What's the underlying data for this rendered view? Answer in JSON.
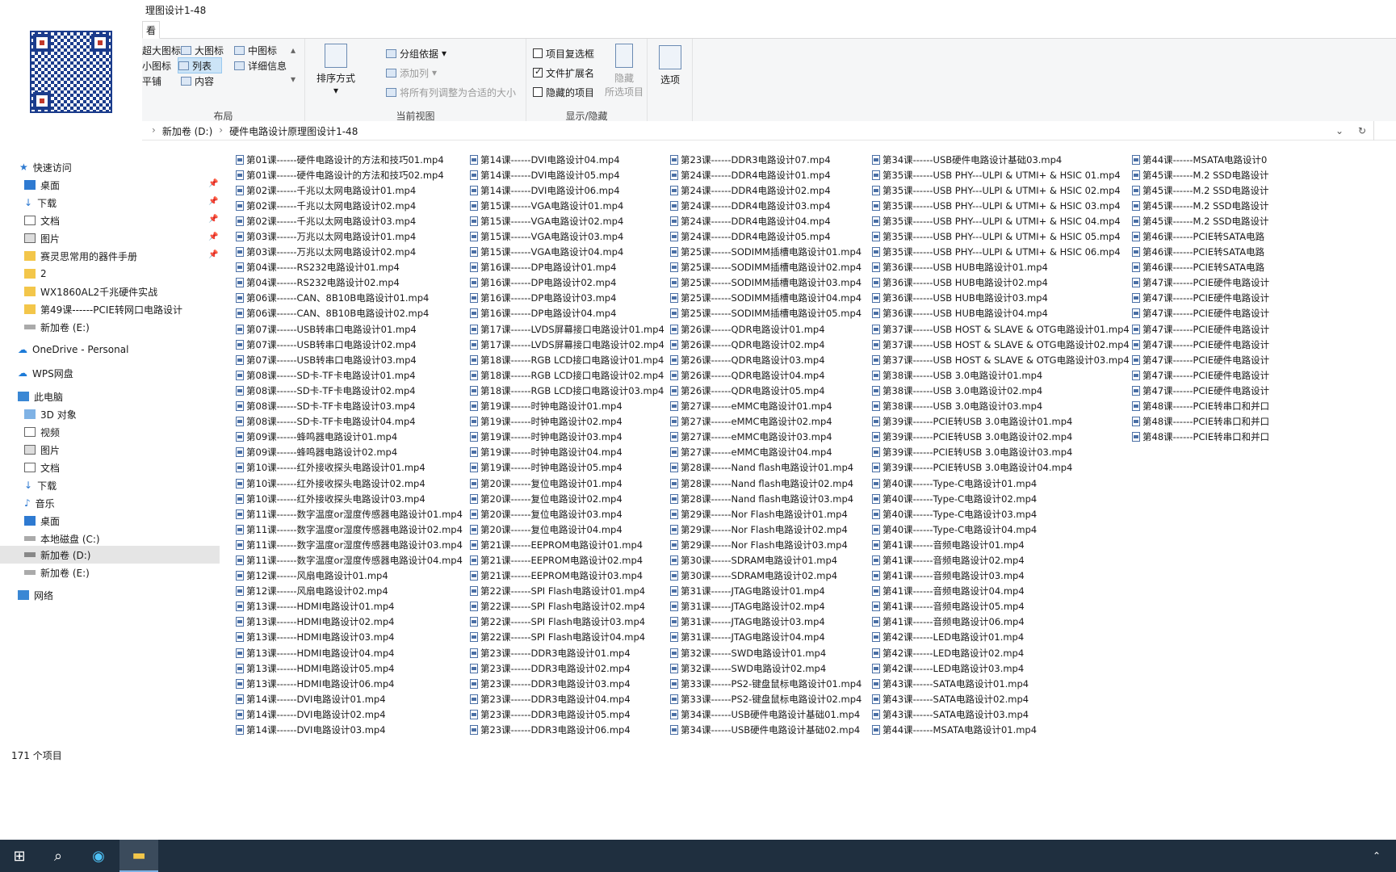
{
  "window": {
    "title": "理图设计1-48",
    "tab": "看"
  },
  "ribbon": {
    "layout": {
      "name": "布局",
      "items": [
        "超大图标",
        "大图标",
        "中图标",
        "小图标",
        "列表",
        "详细信息",
        "平铺",
        "内容"
      ]
    },
    "view": {
      "name": "当前视图",
      "sort": "排序方式",
      "group": "分组依据",
      "addcol": "添加列",
      "fit": "将所有列调整为合适的大小"
    },
    "showhide": {
      "name": "显示/隐藏",
      "chk1": "项目复选框",
      "chk2": "文件扩展名",
      "chk3": "隐藏的项目",
      "hide": "隐藏",
      "hide2": "所选项目"
    },
    "options": "选项"
  },
  "address": {
    "parts": [
      "新加卷 (D:)",
      "›",
      "硬件电路设计原理图设计1-48"
    ]
  },
  "nav": {
    "quick": "快速访问",
    "items": [
      "桌面",
      "下载",
      "文档",
      "图片",
      "赛灵思常用的器件手册",
      "2",
      "WX1860AL2千兆硬件实战",
      "第49课------PCIE转网口电路设计",
      "新加卷 (E:)"
    ],
    "onedrive": "OneDrive - Personal",
    "wps": "WPS网盘",
    "pc": "此电脑",
    "pcitems": [
      "3D 对象",
      "视频",
      "图片",
      "文档",
      "下载",
      "音乐",
      "桌面",
      "本地磁盘 (C:)",
      "新加卷 (D:)",
      "新加卷 (E:)"
    ],
    "network": "网络"
  },
  "files": {
    "col1": [
      "第01课------硬件电路设计的方法和技巧01.mp4",
      "第01课------硬件电路设计的方法和技巧02.mp4",
      "第02课------千兆以太网电路设计01.mp4",
      "第02课------千兆以太网电路设计02.mp4",
      "第02课------千兆以太网电路设计03.mp4",
      "第03课------万兆以太网电路设计01.mp4",
      "第03课------万兆以太网电路设计02.mp4",
      "第04课------RS232电路设计01.mp4",
      "第04课------RS232电路设计02.mp4",
      "第06课------CAN、8B10B电路设计01.mp4",
      "第06课------CAN、8B10B电路设计02.mp4",
      "第07课------USB转串口电路设计01.mp4",
      "第07课------USB转串口电路设计02.mp4",
      "第07课------USB转串口电路设计03.mp4",
      "第08课------SD卡-TF卡电路设计01.mp4",
      "第08课------SD卡-TF卡电路设计02.mp4",
      "第08课------SD卡-TF卡电路设计03.mp4",
      "第08课------SD卡-TF卡电路设计04.mp4",
      "第09课------蜂鸣器电路设计01.mp4",
      "第09课------蜂鸣器电路设计02.mp4",
      "第10课------红外接收探头电路设计01.mp4",
      "第10课------红外接收探头电路设计02.mp4",
      "第10课------红外接收探头电路设计03.mp4",
      "第11课------数字温度or湿度传感器电路设计01.mp4",
      "第11课------数字温度or湿度传感器电路设计02.mp4",
      "第11课------数字温度or湿度传感器电路设计03.mp4",
      "第11课------数字温度or湿度传感器电路设计04.mp4",
      "第12课------风扇电路设计01.mp4",
      "第12课------风扇电路设计02.mp4",
      "第13课------HDMI电路设计01.mp4",
      "第13课------HDMI电路设计02.mp4",
      "第13课------HDMI电路设计03.mp4",
      "第13课------HDMI电路设计04.mp4",
      "第13课------HDMI电路设计05.mp4",
      "第13课------HDMI电路设计06.mp4",
      "第14课------DVI电路设计01.mp4",
      "第14课------DVI电路设计02.mp4",
      "第14课------DVI电路设计03.mp4"
    ],
    "col2": [
      "第14课------DVI电路设计04.mp4",
      "第14课------DVI电路设计05.mp4",
      "第14课------DVI电路设计06.mp4",
      "第15课------VGA电路设计01.mp4",
      "第15课------VGA电路设计02.mp4",
      "第15课------VGA电路设计03.mp4",
      "第15课------VGA电路设计04.mp4",
      "第16课------DP电路设计01.mp4",
      "第16课------DP电路设计02.mp4",
      "第16课------DP电路设计03.mp4",
      "第16课------DP电路设计04.mp4",
      "第17课------LVDS屏幕接口电路设计01.mp4",
      "第17课------LVDS屏幕接口电路设计02.mp4",
      "第18课------RGB LCD接口电路设计01.mp4",
      "第18课------RGB LCD接口电路设计02.mp4",
      "第18课------RGB LCD接口电路设计03.mp4",
      "第19课------时钟电路设计01.mp4",
      "第19课------时钟电路设计02.mp4",
      "第19课------时钟电路设计03.mp4",
      "第19课------时钟电路设计04.mp4",
      "第19课------时钟电路设计05.mp4",
      "第20课------复位电路设计01.mp4",
      "第20课------复位电路设计02.mp4",
      "第20课------复位电路设计03.mp4",
      "第20课------复位电路设计04.mp4",
      "第21课------EEPROM电路设计01.mp4",
      "第21课------EEPROM电路设计02.mp4",
      "第21课------EEPROM电路设计03.mp4",
      "第22课------SPI Flash电路设计01.mp4",
      "第22课------SPI Flash电路设计02.mp4",
      "第22课------SPI Flash电路设计03.mp4",
      "第22课------SPI Flash电路设计04.mp4",
      "第23课------DDR3电路设计01.mp4",
      "第23课------DDR3电路设计02.mp4",
      "第23课------DDR3电路设计03.mp4",
      "第23课------DDR3电路设计04.mp4",
      "第23课------DDR3电路设计05.mp4",
      "第23课------DDR3电路设计06.mp4"
    ],
    "col3": [
      "第23课------DDR3电路设计07.mp4",
      "第24课------DDR4电路设计01.mp4",
      "第24课------DDR4电路设计02.mp4",
      "第24课------DDR4电路设计03.mp4",
      "第24课------DDR4电路设计04.mp4",
      "第24课------DDR4电路设计05.mp4",
      "第25课------SODIMM插槽电路设计01.mp4",
      "第25课------SODIMM插槽电路设计02.mp4",
      "第25课------SODIMM插槽电路设计03.mp4",
      "第25课------SODIMM插槽电路设计04.mp4",
      "第25课------SODIMM插槽电路设计05.mp4",
      "第26课------QDR电路设计01.mp4",
      "第26课------QDR电路设计02.mp4",
      "第26课------QDR电路设计03.mp4",
      "第26课------QDR电路设计04.mp4",
      "第26课------QDR电路设计05.mp4",
      "第27课------eMMC电路设计01.mp4",
      "第27课------eMMC电路设计02.mp4",
      "第27课------eMMC电路设计03.mp4",
      "第27课------eMMC电路设计04.mp4",
      "第28课------Nand flash电路设计01.mp4",
      "第28课------Nand flash电路设计02.mp4",
      "第28课------Nand flash电路设计03.mp4",
      "第29课------Nor Flash电路设计01.mp4",
      "第29课------Nor Flash电路设计02.mp4",
      "第29课------Nor Flash电路设计03.mp4",
      "第30课------SDRAM电路设计01.mp4",
      "第30课------SDRAM电路设计02.mp4",
      "第31课------JTAG电路设计01.mp4",
      "第31课------JTAG电路设计02.mp4",
      "第31课------JTAG电路设计03.mp4",
      "第31课------JTAG电路设计04.mp4",
      "第32课------SWD电路设计01.mp4",
      "第32课------SWD电路设计02.mp4",
      "第33课------PS2-键盘鼠标电路设计01.mp4",
      "第33课------PS2-键盘鼠标电路设计02.mp4",
      "第34课------USB硬件电路设计基础01.mp4",
      "第34课------USB硬件电路设计基础02.mp4"
    ],
    "col4": [
      "第34课------USB硬件电路设计基础03.mp4",
      "第35课------USB PHY---ULPI & UTMI+ & HSIC 01.mp4",
      "第35课------USB PHY---ULPI & UTMI+ & HSIC 02.mp4",
      "第35课------USB PHY---ULPI & UTMI+ & HSIC 03.mp4",
      "第35课------USB PHY---ULPI & UTMI+ & HSIC 04.mp4",
      "第35课------USB PHY---ULPI & UTMI+ & HSIC 05.mp4",
      "第35课------USB PHY---ULPI & UTMI+ & HSIC 06.mp4",
      "第36课------USB HUB电路设计01.mp4",
      "第36课------USB HUB电路设计02.mp4",
      "第36课------USB HUB电路设计03.mp4",
      "第36课------USB HUB电路设计04.mp4",
      "第37课------USB HOST & SLAVE & OTG电路设计01.mp4",
      "第37课------USB HOST & SLAVE & OTG电路设计02.mp4",
      "第37课------USB HOST & SLAVE & OTG电路设计03.mp4",
      "第38课------USB 3.0电路设计01.mp4",
      "第38课------USB 3.0电路设计02.mp4",
      "第38课------USB 3.0电路设计03.mp4",
      "第39课------PCIE转USB 3.0电路设计01.mp4",
      "第39课------PCIE转USB 3.0电路设计02.mp4",
      "第39课------PCIE转USB 3.0电路设计03.mp4",
      "第39课------PCIE转USB 3.0电路设计04.mp4",
      "第40课------Type-C电路设计01.mp4",
      "第40课------Type-C电路设计02.mp4",
      "第40课------Type-C电路设计03.mp4",
      "第40课------Type-C电路设计04.mp4",
      "第41课------音频电路设计01.mp4",
      "第41课------音频电路设计02.mp4",
      "第41课------音频电路设计03.mp4",
      "第41课------音频电路设计04.mp4",
      "第41课------音频电路设计05.mp4",
      "第41课------音频电路设计06.mp4",
      "第42课------LED电路设计01.mp4",
      "第42课------LED电路设计02.mp4",
      "第42课------LED电路设计03.mp4",
      "第43课------SATA电路设计01.mp4",
      "第43课------SATA电路设计02.mp4",
      "第43课------SATA电路设计03.mp4",
      "第44课------MSATA电路设计01.mp4"
    ],
    "col5": [
      "第44课------MSATA电路设计0",
      "第45课------M.2 SSD电路设计",
      "第45课------M.2 SSD电路设计",
      "第45课------M.2 SSD电路设计",
      "第45课------M.2 SSD电路设计",
      "第46课------PCIE转SATA电路",
      "第46课------PCIE转SATA电路",
      "第46课------PCIE转SATA电路",
      "第47课------PCIE硬件电路设计",
      "第47课------PCIE硬件电路设计",
      "第47课------PCIE硬件电路设计",
      "第47课------PCIE硬件电路设计",
      "第47课------PCIE硬件电路设计",
      "第47课------PCIE硬件电路设计",
      "第47课------PCIE硬件电路设计",
      "第47课------PCIE硬件电路设计",
      "第48课------PCIE转串口和并口",
      "第48课------PCIE转串口和并口",
      "第48课------PCIE转串口和并口"
    ]
  },
  "status": "171 个项目"
}
